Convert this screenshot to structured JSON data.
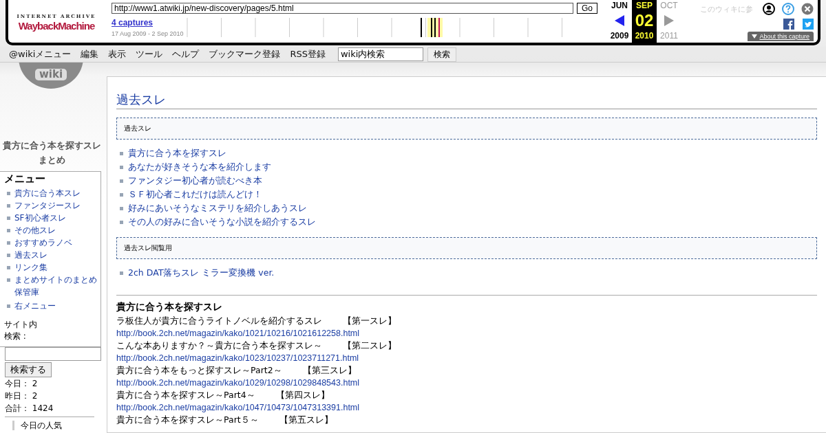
{
  "wayback": {
    "logo_top": "INTERNET ARCHIVE",
    "logo_main": "WaybackMachine",
    "url": "http://www1.atwiki.jp/new-discovery/pages/5.html",
    "go": "Go",
    "captures": "4 captures",
    "range": "17 Aug 2009 - 2 Sep 2010",
    "months": [
      {
        "month": "JUN",
        "year": "2009",
        "selected": false
      },
      {
        "month": "SEP",
        "day": "02",
        "year": "2010",
        "selected": true
      },
      {
        "month": "OCT",
        "year": "2011",
        "selected": false
      }
    ],
    "about": "About this capture",
    "faded_text": "このウィキに参"
  },
  "logo_text": "wiki",
  "menubar": {
    "items": [
      "@wikiメニュー",
      "編集",
      "表示",
      "ツール",
      "ヘルプ",
      "ブックマーク登録",
      "RSS登録"
    ],
    "search_value": "wiki内検索",
    "search_button": "検索"
  },
  "sidebar": {
    "site_title": "貴方に合う本を探すスレまとめ",
    "menu_title": "メニュー",
    "menu_items": [
      "貴方に合う本スレ",
      "ファンタジースレ",
      "SF初心者スレ",
      "その他スレ",
      "おすすめラノベ",
      "過去スレ",
      "リンク集",
      "まとめサイトのまとめ保管庫",
      "右メニュー"
    ],
    "search_label": "サイト内検索 :",
    "search_button": "検索する",
    "stats": [
      {
        "label": "今日：",
        "value": "2"
      },
      {
        "label": "昨日：",
        "value": "2"
      },
      {
        "label": "合計：",
        "value": "1424"
      }
    ],
    "popular_title": "今日の人気"
  },
  "main": {
    "title": "過去スレ",
    "sections": [
      {
        "box": "過去スレ",
        "links": [
          "貴方に合う本を探すスレ",
          "あなたが好きそうな本を紹介します",
          "ファンタジー初心者が読むべき本",
          "ＳＦ初心者これだけは読んどけ！",
          "好みにあいそうなミステリを紹介しあうスレ",
          "その人の好みに合いそうな小説を紹介するスレ"
        ]
      },
      {
        "box": "過去スレ閲覧用",
        "links": [
          "2ch DAT落ちスレ ミラー変換機 ver."
        ]
      }
    ],
    "heading": "貴方に合う本を探すスレ",
    "threads": [
      {
        "title": "ラ板住人が貴方に合うライトノベルを紹介するスレ",
        "tag": "【第一スレ】",
        "url": "http://book.2ch.net/magazin/kako/1021/10216/1021612258.html"
      },
      {
        "title": "こんな本ありますか？～貴方に合う本を探すスレ～",
        "tag": "【第二スレ】",
        "url": "http://book.2ch.net/magazin/kako/1023/10237/1023711271.html"
      },
      {
        "title": "貴方に合う本をもっと探すスレ～Part2～",
        "tag": "【第三スレ】",
        "url": "http://book.2ch.net/magazin/kako/1029/10298/1029848543.html"
      },
      {
        "title": "貴方に合う本を探すスレ～Part4～",
        "tag": "【第四スレ】",
        "url": "http://book.2ch.net/magazin/kako/1047/10473/1047313391.html"
      },
      {
        "title": "貴方に合う本を探すスレ～Part５～",
        "tag": "【第五スレ】"
      }
    ]
  }
}
